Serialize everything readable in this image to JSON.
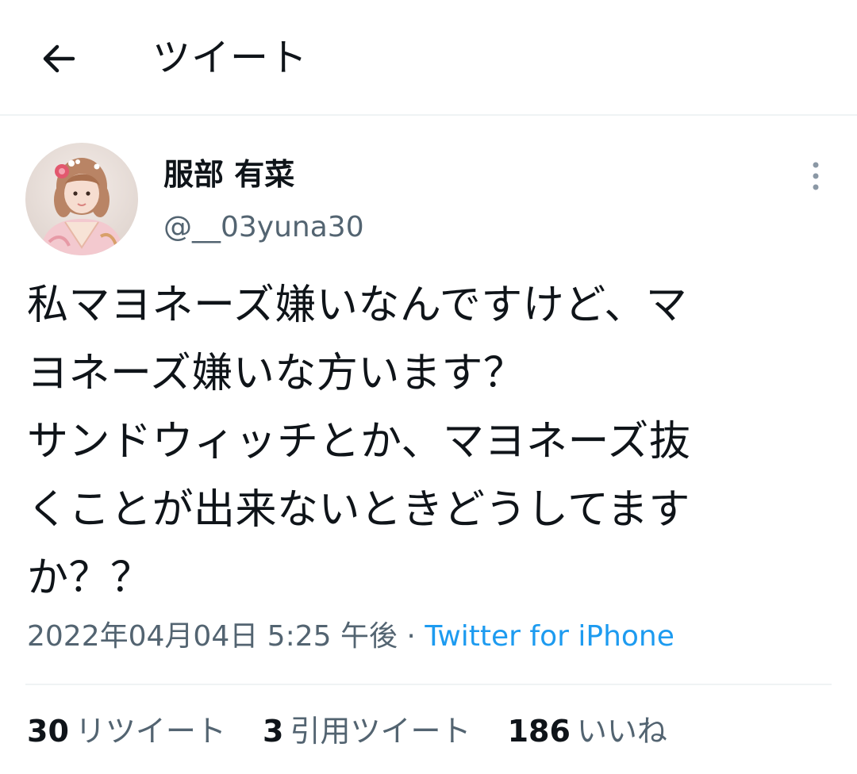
{
  "header": {
    "title": "ツイート",
    "back_icon": "arrow-left-icon"
  },
  "author": {
    "name": "服部 有菜",
    "handle": "@__03yuna30",
    "avatar_icon": "profile-photo"
  },
  "tweet": {
    "text": "私マヨネーズ嫌いなんですけど、マ\nヨネーズ嫌いな方います？\nサンドウィッチとか、マヨネーズ抜\nくことが出来ないときどうしてます\nか？？",
    "date_time": "2022年04月04日 5:25 午後",
    "separator": "·",
    "source": "Twitter for iPhone"
  },
  "stats": {
    "retweets_count": "30",
    "retweets_label": "リツイート",
    "quotes_count": "3",
    "quotes_label": "引用ツイート",
    "likes_count": "186",
    "likes_label": "いいね"
  },
  "colors": {
    "text_primary": "#0f1419",
    "text_secondary": "#536471",
    "link": "#1d9bf0",
    "divider": "#eff3f4"
  }
}
